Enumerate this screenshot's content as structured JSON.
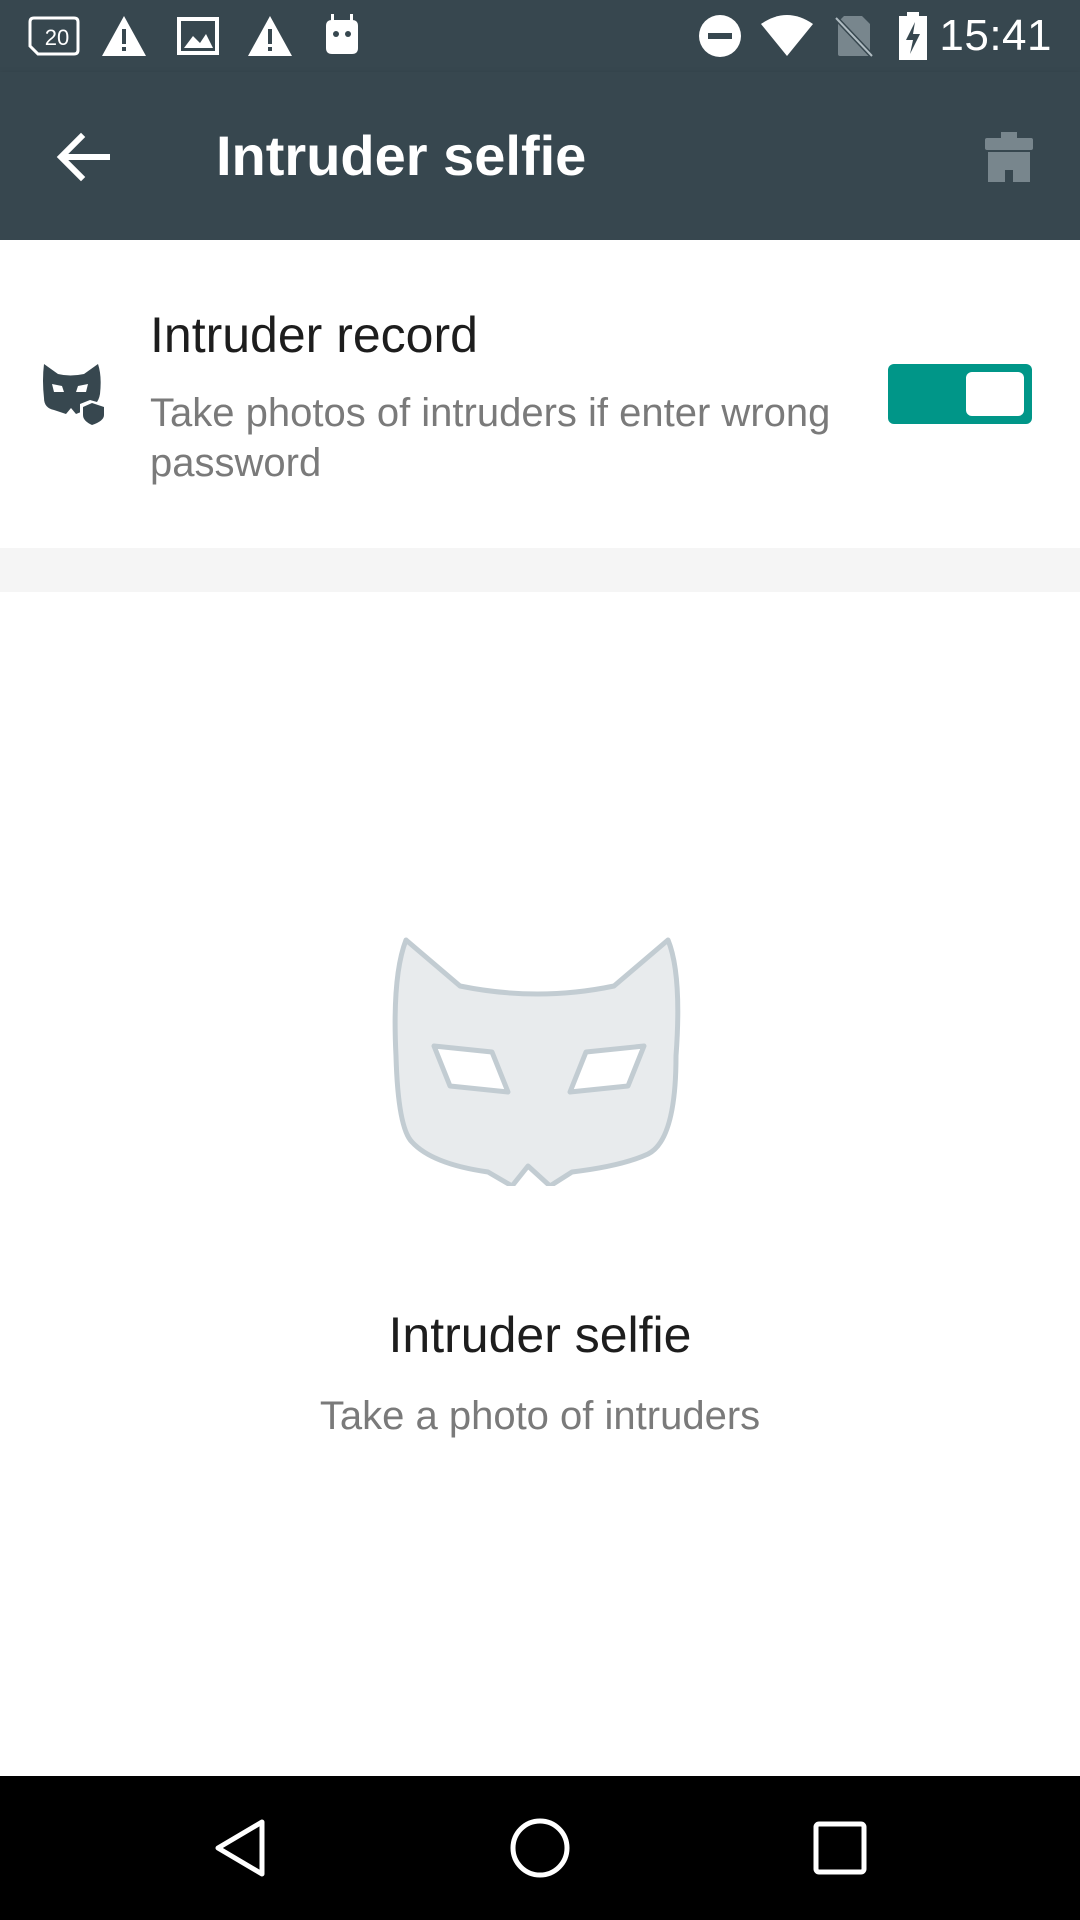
{
  "status_bar": {
    "time": "15:41",
    "notification_badge": "20",
    "icons_left": [
      "sim-20-icon",
      "warning-icon",
      "image-icon",
      "warning-icon",
      "android-icon"
    ],
    "icons_right": [
      "do-not-disturb-icon",
      "wifi-icon",
      "no-sim-icon",
      "battery-charging-icon"
    ]
  },
  "app_bar": {
    "title": "Intruder selfie",
    "back_icon": "arrow-back-icon",
    "action_icon": "trash-icon",
    "background_color": "#37474f"
  },
  "setting": {
    "title": "Intruder record",
    "description": "Take photos of intruders if enter wrong password",
    "icon": "mask-shield-icon",
    "toggle_on": true,
    "accent_color": "#009688"
  },
  "empty_state": {
    "icon": "mask-icon",
    "title": "Intruder selfie",
    "subtitle": "Take a photo of intruders"
  },
  "nav_bar": {
    "buttons": [
      "back-triangle-icon",
      "home-circle-icon",
      "recents-square-icon"
    ]
  }
}
